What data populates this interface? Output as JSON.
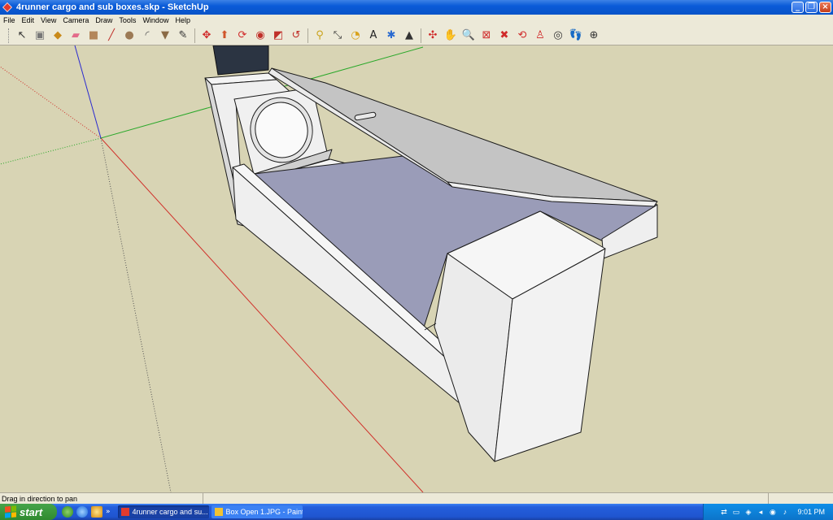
{
  "window": {
    "title": "4runner cargo and sub boxes.skp - SketchUp",
    "min_label": "_",
    "max_label": "❐",
    "close_label": "×"
  },
  "menu": [
    "File",
    "Edit",
    "View",
    "Camera",
    "Draw",
    "Tools",
    "Window",
    "Help"
  ],
  "toolbar": {
    "tools": [
      {
        "name": "select-tool-icon",
        "glyph": "↖",
        "color": "#333333"
      },
      {
        "name": "make-component-icon",
        "glyph": "▣",
        "color": "#777777"
      },
      {
        "name": "paint-bucket-icon",
        "glyph": "◆",
        "color": "#c98a1a"
      },
      {
        "name": "eraser-icon",
        "glyph": "▰",
        "color": "#e36a8a"
      },
      {
        "name": "rectangle-icon",
        "glyph": "■",
        "color": "#b3865a"
      },
      {
        "name": "line-icon",
        "glyph": "╱",
        "color": "#c0302a"
      },
      {
        "name": "circle-icon",
        "glyph": "●",
        "color": "#9c7a55"
      },
      {
        "name": "arc-icon",
        "glyph": "◜",
        "color": "#555555"
      },
      {
        "name": "polygon-icon",
        "glyph": "▼",
        "color": "#8a6a45"
      },
      {
        "name": "freehand-icon",
        "glyph": "✎",
        "color": "#333333"
      },
      {
        "name": "move-icon",
        "glyph": "✥",
        "color": "#d02a2a"
      },
      {
        "name": "push-pull-icon",
        "glyph": "⬆",
        "color": "#d0552a"
      },
      {
        "name": "rotate-icon",
        "glyph": "⟳",
        "color": "#d02a2a"
      },
      {
        "name": "follow-me-icon",
        "glyph": "◉",
        "color": "#c0302a"
      },
      {
        "name": "scale-icon",
        "glyph": "◩",
        "color": "#c0302a"
      },
      {
        "name": "offset-icon",
        "glyph": "↺",
        "color": "#c0302a"
      },
      {
        "name": "tape-measure-icon",
        "glyph": "⚲",
        "color": "#c9a21a"
      },
      {
        "name": "dimension-icon",
        "glyph": "⤡",
        "color": "#333333"
      },
      {
        "name": "protractor-icon",
        "glyph": "◔",
        "color": "#d9a21a"
      },
      {
        "name": "text-icon",
        "glyph": "A",
        "color": "#222222"
      },
      {
        "name": "axes-icon",
        "glyph": "✱",
        "color": "#2a6ad0"
      },
      {
        "name": "3d-text-icon",
        "glyph": "▲",
        "color": "#333333"
      },
      {
        "name": "orbit-icon",
        "glyph": "✣",
        "color": "#d02a2a"
      },
      {
        "name": "pan-icon",
        "glyph": "✋",
        "color": "#555555"
      },
      {
        "name": "zoom-icon",
        "glyph": "🔍",
        "color": "#333333"
      },
      {
        "name": "zoom-window-icon",
        "glyph": "⊠",
        "color": "#d02a2a"
      },
      {
        "name": "zoom-extents-icon",
        "glyph": "✖",
        "color": "#d02a2a"
      },
      {
        "name": "previous-view-icon",
        "glyph": "⟲",
        "color": "#d02a2a"
      },
      {
        "name": "position-camera-icon",
        "glyph": "♙",
        "color": "#d02a2a"
      },
      {
        "name": "look-around-icon",
        "glyph": "◎",
        "color": "#333333"
      },
      {
        "name": "walk-icon",
        "glyph": "👣",
        "color": "#333333"
      },
      {
        "name": "section-plane-icon",
        "glyph": "⊕",
        "color": "#333333"
      }
    ]
  },
  "status": {
    "message": "Drag in direction to pan"
  },
  "taskbar": {
    "start_label": "start",
    "quick_more": "»",
    "tasks": [
      {
        "label": "4runner cargo and su...",
        "active": true
      },
      {
        "label": "Box Open 1.JPG - Paint",
        "active": false
      }
    ],
    "clock": "9:01 PM"
  },
  "colors": {
    "viewport_bg": "#d8d4b4",
    "face_light": "#f2f2f2",
    "face_shade": "#c8c8c8",
    "face_blue": "#9a9cb8",
    "lid": "#c4c4c4",
    "edge": "#1a1a1a",
    "axis_red": "#d0302a",
    "axis_green": "#2aa82a",
    "axis_blue": "#2a2ad0"
  }
}
